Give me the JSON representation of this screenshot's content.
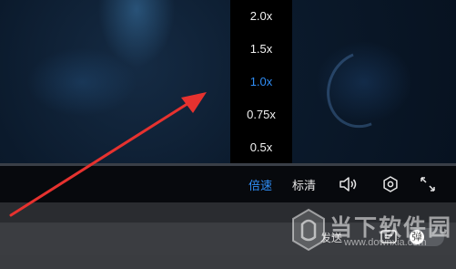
{
  "colors": {
    "accent": "#2f8df5",
    "annotation_arrow": "#e6322f"
  },
  "speed_menu": {
    "options": [
      "2.0x",
      "1.5x",
      "1.0x",
      "0.75x",
      "0.5x"
    ],
    "selected": "1.0x"
  },
  "controls": {
    "speed_label": "倍速",
    "quality_label": "标清",
    "icons": [
      "volume-icon",
      "settings-icon",
      "fullscreen-icon"
    ]
  },
  "danmu_bar": {
    "send_label": "发送",
    "toggle_label": "弹"
  },
  "watermark": {
    "title": "当下软件园",
    "url": "www.downxia.com"
  }
}
